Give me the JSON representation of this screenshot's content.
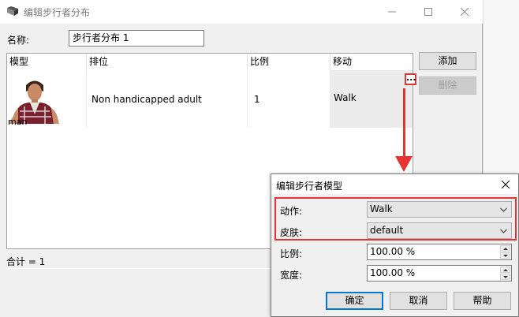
{
  "main_window": {
    "title": "编辑步行者分布",
    "name_label": "名称:",
    "name_value": "步行者分布 1",
    "table": {
      "columns": [
        "模型",
        "排位",
        "比例",
        "移动"
      ],
      "rows": [
        {
          "model_caption": "man",
          "rank": "Non handicapped adult",
          "ratio": "1",
          "move": "Walk",
          "ellipsis": "..."
        }
      ]
    },
    "add_button": "添加",
    "delete_button": "删除",
    "total_text": "合计 = 1"
  },
  "dialog": {
    "title": "编辑步行者模型",
    "action_label": "动作:",
    "action_value": "Walk",
    "skin_label": "皮肤:",
    "skin_value": "default",
    "scale_label": "比例:",
    "scale_value": "100.00 %",
    "width_label": "宽度:",
    "width_value": "100.00 %",
    "ok_button": "确定",
    "cancel_button": "取消",
    "help_button": "帮助"
  },
  "colors": {
    "highlight": "#e63333",
    "default_button_border": "#0078d7"
  }
}
